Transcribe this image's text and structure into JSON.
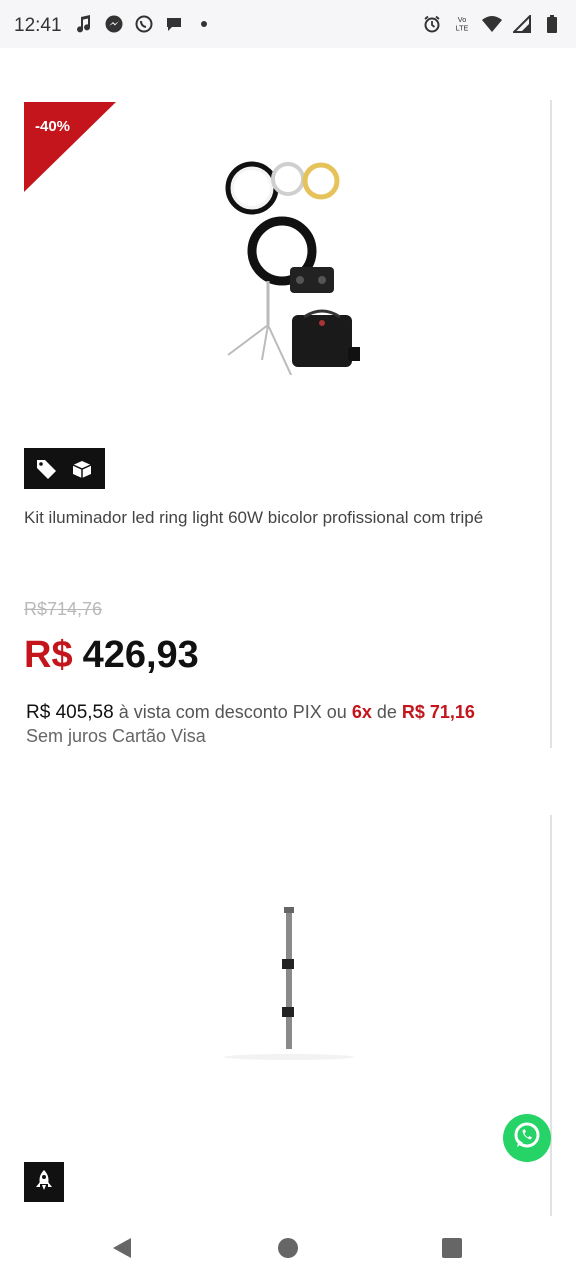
{
  "status_bar": {
    "time": "12:41",
    "left_icons": [
      "music-note-icon",
      "messenger-icon",
      "whatsapp-icon",
      "chat-bubble-icon",
      "dot-icon"
    ],
    "right_icons": [
      "alarm-icon",
      "volte-icon",
      "wifi-icon",
      "signal-icon",
      "battery-icon"
    ],
    "volte_label_top": "Vo",
    "volte_label_bottom": "LTE"
  },
  "product1": {
    "discount": "-40%",
    "title": "Kit iluminador led ring light 60W bicolor profissional com tripé",
    "old_price": "R$714,76",
    "price_currency": "R$",
    "price_value": "426,93",
    "pix_price": "R$ 405,58",
    "pix_text": " à vista com desconto PIX ou ",
    "installments_count": "6x",
    "installments_de": " de ",
    "installment_value": "R$ 71,16",
    "installment_note": "Sem juros Cartão Visa",
    "badge_icons": [
      "tag-icon",
      "box-icon"
    ],
    "accent_color": "#c4151c"
  },
  "product2": {
    "badge_icon": "rocket-icon"
  },
  "fab": {
    "icon": "whatsapp-icon",
    "color": "#25d366"
  },
  "nav": {
    "icons": [
      "back-icon",
      "home-icon",
      "recents-icon"
    ]
  }
}
